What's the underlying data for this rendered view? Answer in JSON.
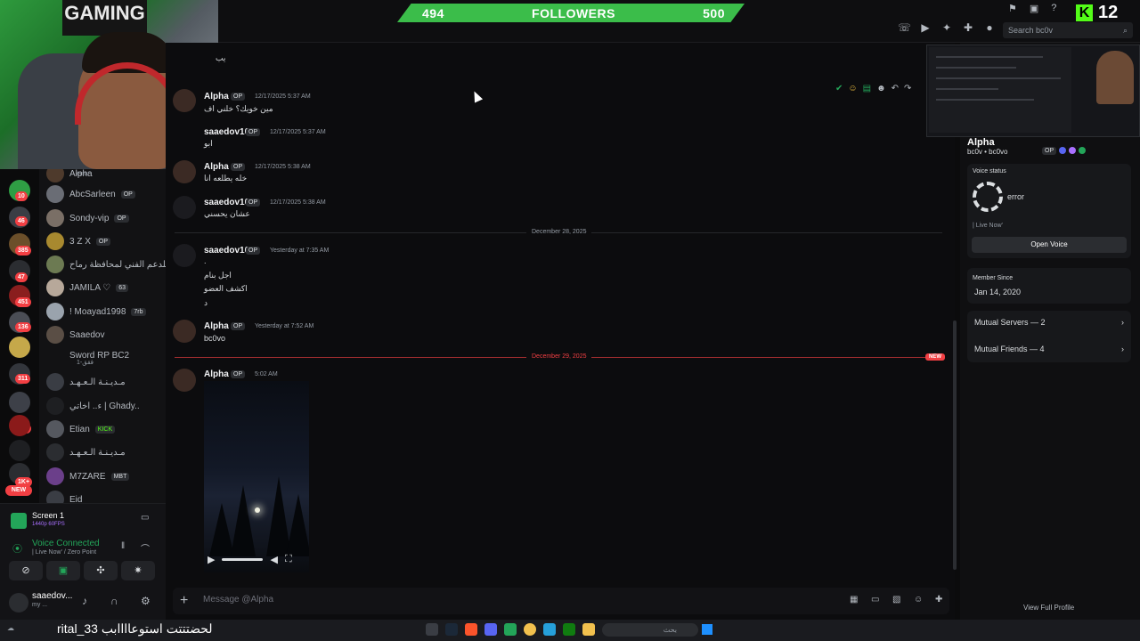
{
  "stream": {
    "followers_left": "494",
    "followers_label": "FOLLOWERS",
    "followers_right": "500",
    "kick_logo": "K",
    "kick_count": "12",
    "webcam_banner": "GAMING",
    "bottom_text": "rital_33 لحضتتتت استوعاااابب"
  },
  "header": {
    "search_placeholder": "Search bc0v",
    "icons": [
      "phone-icon",
      "video-icon",
      "pin-icon",
      "add-friend-icon",
      "profile-icon"
    ]
  },
  "server_badges": [
    "10",
    "46",
    "385",
    "47",
    "451",
    "136",
    "311",
    "153",
    "1K+"
  ],
  "new_pill": "NEW",
  "members": [
    {
      "name": "Alpha",
      "sub": "error",
      "tag": ""
    },
    {
      "name": "AbcSarleen",
      "tag": "OP"
    },
    {
      "name": "Sondy-vip",
      "tag": "OP"
    },
    {
      "name": "3 Z X",
      "tag": "OP"
    },
    {
      "name": "للدعم الفني لمحافظة رماح",
      "tag": ""
    },
    {
      "name": "JAMILA ♡",
      "tag": "63"
    },
    {
      "name": "! Moayad1998",
      "tag": "7rb"
    },
    {
      "name": "Saaedov",
      "tag": ""
    },
    {
      "name": "Sword RP BC2",
      "sub": "ققق-1",
      "tag": ""
    },
    {
      "name": "مـديـنـة الـعـهـد",
      "tag": ""
    },
    {
      "name": "ء.. اخاتي | Ghady..",
      "tag": ""
    },
    {
      "name": "Etian",
      "tag": "KICK"
    },
    {
      "name": "مـديـنـة الـعـهـد",
      "tag": ""
    },
    {
      "name": "M7ZARE",
      "tag": "MBT"
    },
    {
      "name": "Eid",
      "tag": ""
    }
  ],
  "user_panel": {
    "screen_title": "Screen 1",
    "screen_sub": "1440p 60FPS",
    "voice_status": "Voice Connected",
    "voice_channel": "| Live Now' / Zero Point",
    "me_name": "saaedov...",
    "me_sub": "my ..."
  },
  "chat": {
    "messages": [
      {
        "author": "Alpha",
        "tag": "OP",
        "time": "12/17/2025 5:37 AM",
        "lines": [
          "مين خويك؟ خلني اف"
        ]
      },
      {
        "author": "saaedov10",
        "tag": "OP",
        "time": "12/17/2025 5:37 AM",
        "lines": [
          "ابو"
        ]
      },
      {
        "author": "Alpha",
        "tag": "OP",
        "time": "12/17/2025 5:38 AM",
        "lines": [
          "خله يطلعه انا"
        ]
      },
      {
        "author": "saaedov10",
        "tag": "OP",
        "time": "12/17/2025 5:38 AM",
        "lines": [
          "عشان يحسني"
        ]
      },
      {
        "author": "saaedov10",
        "tag": "OP",
        "time": "Yesterday at 7:35 AM",
        "lines": [
          ".",
          "اجل بنام",
          "اكشف العضو",
          "د"
        ]
      },
      {
        "author": "Alpha",
        "tag": "OP",
        "time": "Yesterday at 7:52 AM",
        "lines": [
          "bc0vo"
        ]
      },
      {
        "author": "Alpha",
        "tag": "OP",
        "time": "5:02 AM",
        "lines": []
      }
    ],
    "divider_1": "December 28, 2025",
    "divider_2": "December 29, 2025",
    "new_tag": "NEW",
    "composer_placeholder": "Message @Alpha",
    "top_fragment": "يب"
  },
  "profile": {
    "name": "Alpha",
    "username": "bc0v • bc0vo",
    "tag": "OP",
    "voice_status_label": "Voice status",
    "voice_status_value": "error",
    "voice_channel": "| Live Now'",
    "open_voice": "Open Voice",
    "member_since_label": "Member Since",
    "member_since_value": "Jan 14, 2020",
    "mutual_servers": "Mutual Servers — 2",
    "mutual_friends": "Mutual Friends — 4",
    "view_full": "View Full Profile"
  },
  "taskbar": {
    "search_text": "بحث"
  }
}
